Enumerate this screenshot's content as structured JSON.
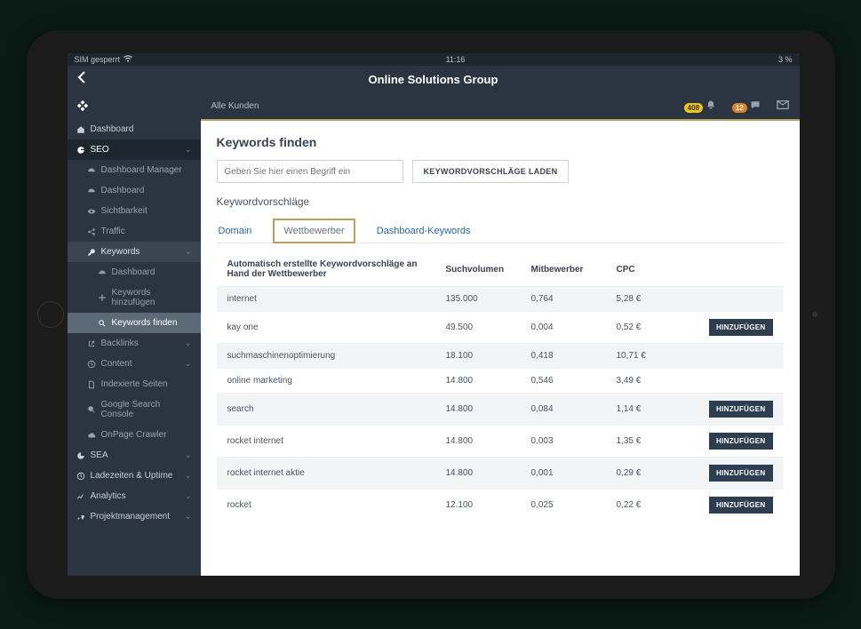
{
  "status_bar": {
    "left": "SIM gesperrt",
    "time": "11:16",
    "right": "3 %"
  },
  "nav_title": "Online Solutions Group",
  "top_strip": {
    "all_customers": "Alle Kunden",
    "badge1": "408",
    "badge2": "12"
  },
  "sidebar": {
    "dashboard": "Dashboard",
    "seo": "SEO",
    "seo_items": {
      "dashboard_manager": "Dashboard Manager",
      "dashboard": "Dashboard",
      "sichtbarkeit": "Sichtbarkeit",
      "traffic": "Traffic",
      "keywords": "Keywords",
      "kw_dashboard": "Dashboard",
      "kw_add": "Keywords hinzufügen",
      "kw_find": "Keywords finden",
      "backlinks": "Backlinks",
      "content": "Content",
      "indexierte": "Indexierte Seiten",
      "gsc": "Google Search Console",
      "onpage": "OnPage Crawler"
    },
    "sea": "SEA",
    "ladezeiten": "Ladezeiten & Uptime",
    "analytics": "Analytics",
    "projektmanagement": "Projektmanagement"
  },
  "panel": {
    "title": "Keywords finden",
    "input_placeholder": "Geben Sie hier einen Begriff ein",
    "load_button": "KEYWORDVORSCHLÄGE LADEN",
    "subtitle": "Keywordvorschläge",
    "tabs": {
      "domain": "Domain",
      "wettbewerber": "Wettbewerber",
      "dashboard_keywords": "Dashboard-Keywords"
    },
    "columns": {
      "c1": "Automatisch erstellte Keywordvorschläge an Hand der Wettbewerber",
      "c2": "Suchvolumen",
      "c3": "Mitbewerber",
      "c4": "CPC"
    },
    "add_label": "HINZUFÜGEN",
    "rows": [
      {
        "kw": "internet",
        "vol": "135.000",
        "comp": "0,764",
        "cpc": "5,28 €",
        "add": false
      },
      {
        "kw": "kay one",
        "vol": "49.500",
        "comp": "0,004",
        "cpc": "0,52 €",
        "add": true
      },
      {
        "kw": "suchmaschinenoptimierung",
        "vol": "18.100",
        "comp": "0,418",
        "cpc": "10,71 €",
        "add": false
      },
      {
        "kw": "online marketing",
        "vol": "14.800",
        "comp": "0,546",
        "cpc": "3,49 €",
        "add": false
      },
      {
        "kw": "search",
        "vol": "14.800",
        "comp": "0,084",
        "cpc": "1,14 €",
        "add": true
      },
      {
        "kw": "rocket internet",
        "vol": "14.800",
        "comp": "0,003",
        "cpc": "1,35 €",
        "add": true
      },
      {
        "kw": "rocket internet aktie",
        "vol": "14.800",
        "comp": "0,001",
        "cpc": "0,29 €",
        "add": true
      },
      {
        "kw": "rocket",
        "vol": "12.100",
        "comp": "0,025",
        "cpc": "0,22 €",
        "add": true
      }
    ]
  }
}
